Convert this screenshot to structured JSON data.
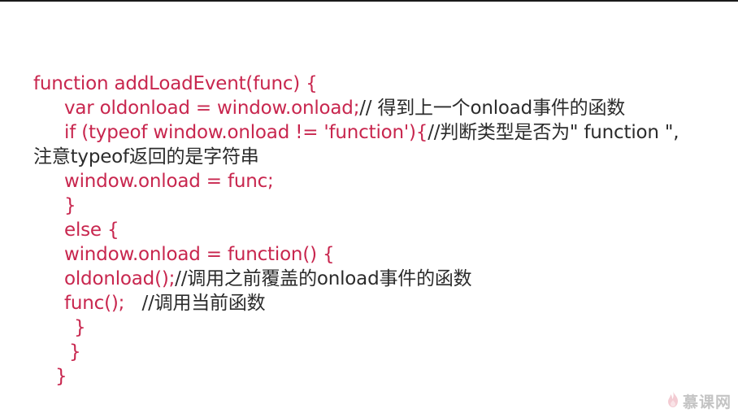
{
  "lines": [
    {
      "code": "function addLoadEvent(func) {",
      "comment": ""
    },
    {
      "code": "var oldonload = window.onload;",
      "comment": "// 得到上一个onload事件的函数"
    },
    {
      "code": "if (typeof window.onload != 'function'){",
      "comment": "//判断类型是否为\" function \","
    },
    {
      "code": "",
      "comment": "注意typeof返回的是字符串"
    },
    {
      "code": "window.onload = func;",
      "comment": ""
    },
    {
      "code": "}",
      "comment": ""
    },
    {
      "code": "else {",
      "comment": ""
    },
    {
      "code": "window.onload = function() {",
      "comment": ""
    },
    {
      "code": "oldonload();",
      "comment": "//调用之前覆盖的onload事件的函数"
    },
    {
      "code": "func();   ",
      "comment": "//调用当前函数"
    },
    {
      "code": "}",
      "comment": ""
    },
    {
      "code": "}",
      "comment": ""
    },
    {
      "code": "}",
      "comment": ""
    }
  ],
  "watermark": {
    "text": "慕课网",
    "icon": "flame-icon",
    "color": "#c8c8c8"
  },
  "colors": {
    "code": "#c8264e",
    "comment": "#2b2b2b"
  }
}
